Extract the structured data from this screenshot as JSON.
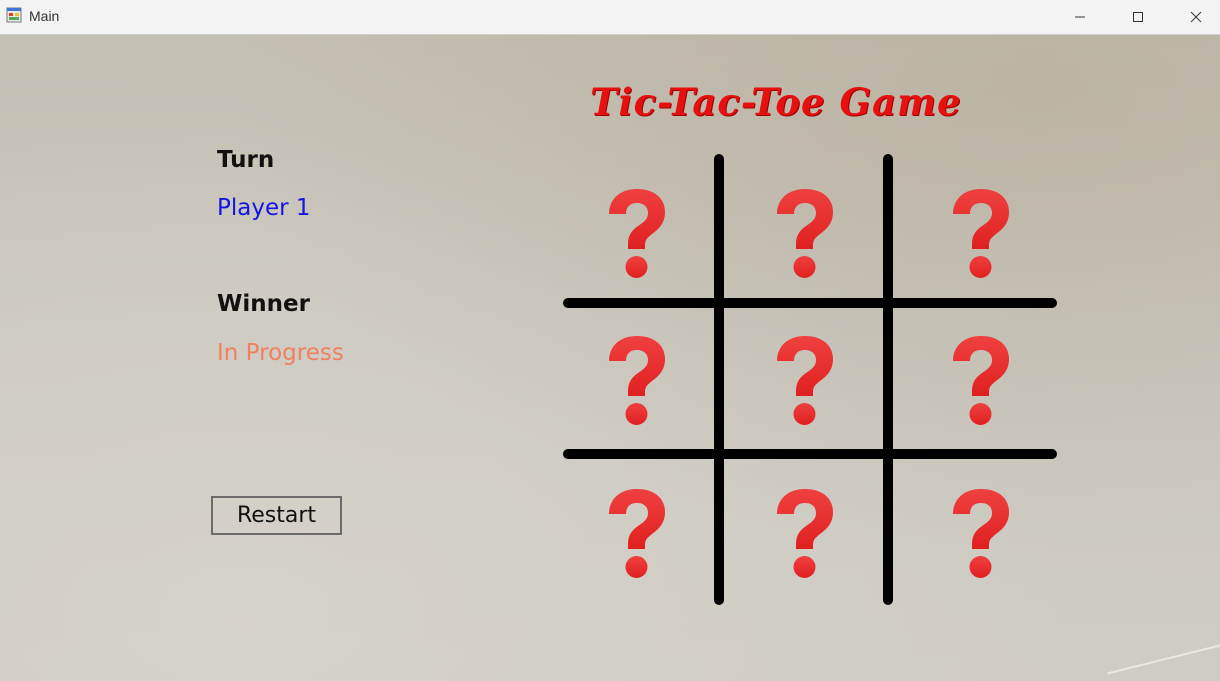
{
  "window": {
    "title": "Main",
    "icons": {
      "app": "form-app-icon",
      "minimize": "minimize-icon",
      "maximize": "maximize-icon",
      "close": "close-icon"
    }
  },
  "game": {
    "title": "Tic-Tac-Toe Game",
    "turn_label": "Turn",
    "turn_value": "Player 1",
    "winner_label": "Winner",
    "winner_value": "In Progress",
    "restart_label": "Restart",
    "board": [
      [
        "?",
        "?",
        "?"
      ],
      [
        "?",
        "?",
        "?"
      ],
      [
        "?",
        "?",
        "?"
      ]
    ],
    "cell_icon": "red-question-mark-icon",
    "colors": {
      "title": "#e61010",
      "turn_value": "#1414e6",
      "winner_value": "#f08060",
      "cell_mark": "#e02020",
      "grid": "#000000"
    }
  }
}
